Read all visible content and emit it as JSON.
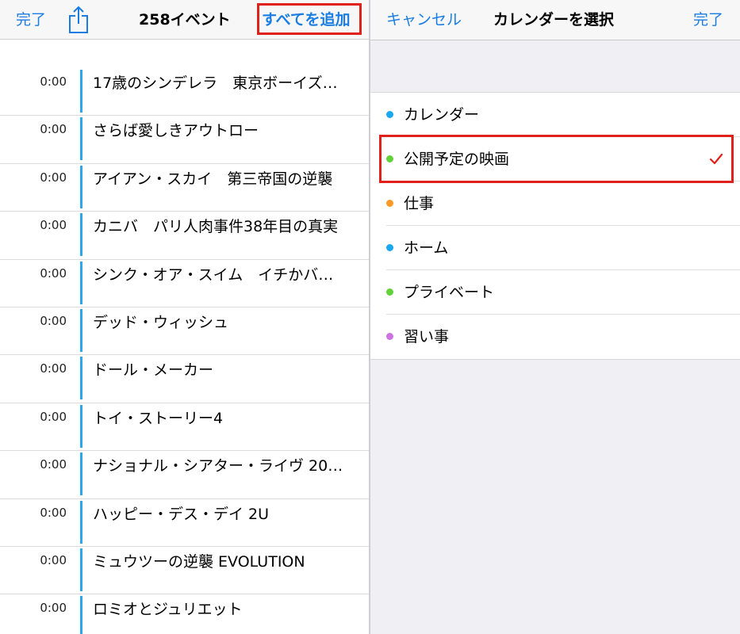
{
  "left": {
    "done_label": "完了",
    "title": "258イベント",
    "add_all_label": "すべてを追加",
    "events": [
      {
        "time": "0:00",
        "title": "17歳のシンデレラ　東京ボーイズ…"
      },
      {
        "time": "0:00",
        "title": "さらば愛しきアウトロー"
      },
      {
        "time": "0:00",
        "title": "アイアン・スカイ　第三帝国の逆襲"
      },
      {
        "time": "0:00",
        "title": "カニバ　パリ人肉事件38年目の真実"
      },
      {
        "time": "0:00",
        "title": "シンク・オア・スイム　イチかバ…"
      },
      {
        "time": "0:00",
        "title": "デッド・ウィッシュ"
      },
      {
        "time": "0:00",
        "title": "ドール・メーカー"
      },
      {
        "time": "0:00",
        "title": "トイ・ストーリー4"
      },
      {
        "time": "0:00",
        "title": "ナショナル・シアター・ライヴ 20…"
      },
      {
        "time": "0:00",
        "title": "ハッピー・デス・デイ 2U"
      },
      {
        "time": "0:00",
        "title": "ミュウツーの逆襲 EVOLUTION"
      },
      {
        "time": "0:00",
        "title": "ロミオとジュリエット"
      }
    ]
  },
  "right": {
    "cancel_label": "キャンセル",
    "title": "カレンダーを選択",
    "done_label": "完了",
    "calendars": [
      {
        "label": "カレンダー",
        "color": "#1aa8f0"
      },
      {
        "label": "公開予定の映画",
        "color": "#63d23a",
        "selected": true
      },
      {
        "label": "仕事",
        "color": "#fb9a25"
      },
      {
        "label": "ホーム",
        "color": "#1aa8f0"
      },
      {
        "label": "プライベート",
        "color": "#63d23a"
      },
      {
        "label": "習い事",
        "color": "#cc73e1"
      }
    ]
  },
  "colors": {
    "accent": "#1a7de3",
    "highlight": "#e0201b",
    "event_bar": "#2fa5ea",
    "checkmark": "#e0201b"
  }
}
